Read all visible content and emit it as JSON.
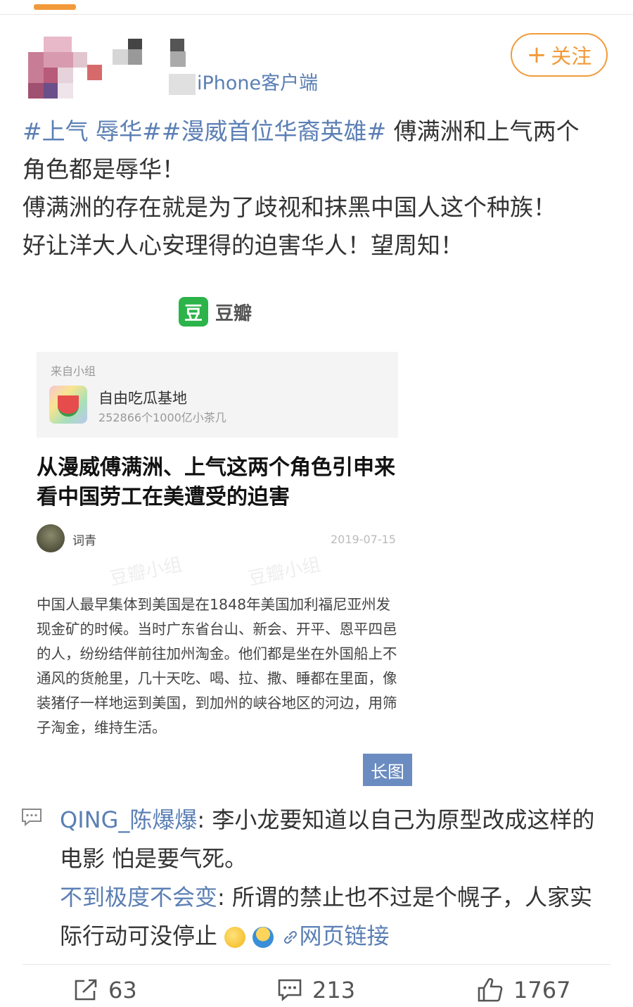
{
  "header": {
    "source_label": "iPhone客户端",
    "follow_label": "关注",
    "follow_plus": "+"
  },
  "post": {
    "tags": [
      "#上气 辱华#",
      "#漫威首位华裔英雄#"
    ],
    "text_line1_suffix": " 傅满洲和上气两个",
    "text_rest": "角色都是辱华！",
    "text_p2": "傅满洲的存在就是为了歧视和抹黑中国人这个种族！",
    "text_p3": "好让洋大人心安理得的迫害华人！望周知！"
  },
  "embed": {
    "brand_logo": "豆",
    "brand_name": "豆瓣",
    "card_from": "来自小组",
    "group_name": "自由吃瓜基地",
    "group_sub": "252866个1000亿小茶几",
    "article_title": "从漫威傅满洲、上气这两个角色引申来看中国劳工在美遭受的迫害",
    "author": "词青",
    "date": "2019-07-15",
    "watermark": "豆瓣小组",
    "body": "中国人最早集体到美国是在1848年美国加利福尼亚州发现金矿的时候。当时广东省台山、新会、开平、恩平四邑的人，纷纷结伴前往加州淘金。他们都是坐在外国船上不通风的货舱里，几十天吃、喝、拉、撒、睡都在里面，像装猪仔一样地运到美国，到加州的峡谷地区的河边，用筛子淘金，维持生活。",
    "long_image_label": "长图"
  },
  "comments": [
    {
      "user": "QING_陈爆爆",
      "sep": ": ",
      "text": "李小龙要知道以自己为原型改成这样的电影 怕是要气死。"
    },
    {
      "user": "不到极度不会变",
      "sep": ": ",
      "text": "所谓的禁止也不过是个幌子，人家实际行动可没停止",
      "link": "网页链接"
    }
  ],
  "actions": {
    "repost_count": "63",
    "comment_count": "213",
    "like_count": "1767"
  },
  "colors": {
    "accent": "#f29a3a",
    "link": "#5b7fb4",
    "douban_green": "#2cb34a"
  }
}
